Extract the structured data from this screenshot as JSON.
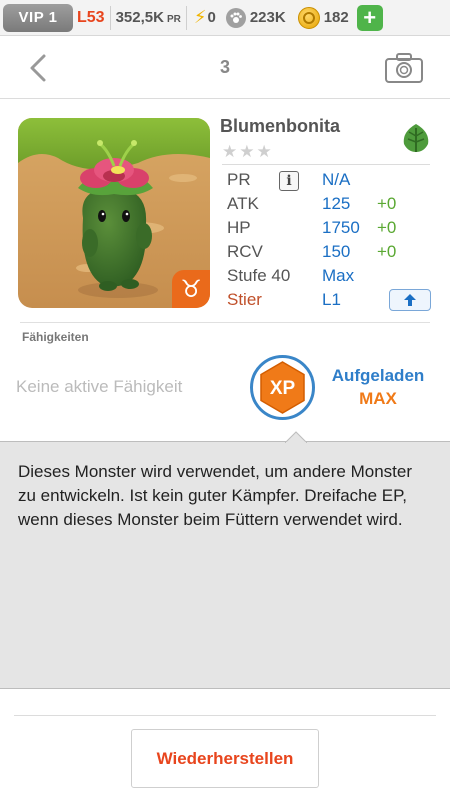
{
  "topbar": {
    "vip_label": "VIP 1",
    "level": "L53",
    "power": "352,5K",
    "power_unit": "PR",
    "energy": "0",
    "food": "223K",
    "gold": "182",
    "plus_label": "+"
  },
  "header": {
    "title": "3",
    "icons": {
      "back": "chevron-left-icon",
      "camera": "camera-icon"
    }
  },
  "monster": {
    "name": "Blumenbonita",
    "element_icon": "leaf-icon",
    "element_color": "#5aa832",
    "stars_filled": 0,
    "stars_total": 3,
    "stars_text": "★★★",
    "zodiac_symbol": "♉",
    "stats": [
      {
        "label": "PR",
        "value": "N/A",
        "bonus": ""
      },
      {
        "label": "ATK",
        "value": "125",
        "bonus": "+0"
      },
      {
        "label": "HP",
        "value": "1750",
        "bonus": "+0"
      },
      {
        "label": "RCV",
        "value": "150",
        "bonus": "+0"
      },
      {
        "label": "Stufe 40",
        "value": "Max",
        "bonus": ""
      },
      {
        "label": "Stier",
        "value": "L1",
        "bonus": ""
      }
    ],
    "info_icon_label": "i"
  },
  "abilities": {
    "heading": "Fähigkeiten",
    "active_none": "Keine aktive Fähigkeit",
    "xp_label": "XP",
    "charged_label": "Aufgeladen",
    "charged_value": "MAX"
  },
  "description": "Dieses Monster wird verwendet, um andere Monster zu entwickeln. Ist kein guter Kämpfer. Dreifache EP, wenn dieses Monster beim Füttern verwendet wird.",
  "actions": {
    "restore_label": "Wiederherstellen"
  },
  "colors": {
    "accent_red": "#e8451d",
    "accent_blue": "#1b6fc4",
    "bonus_green": "#5aa832",
    "xp_orange": "#f07a18"
  }
}
